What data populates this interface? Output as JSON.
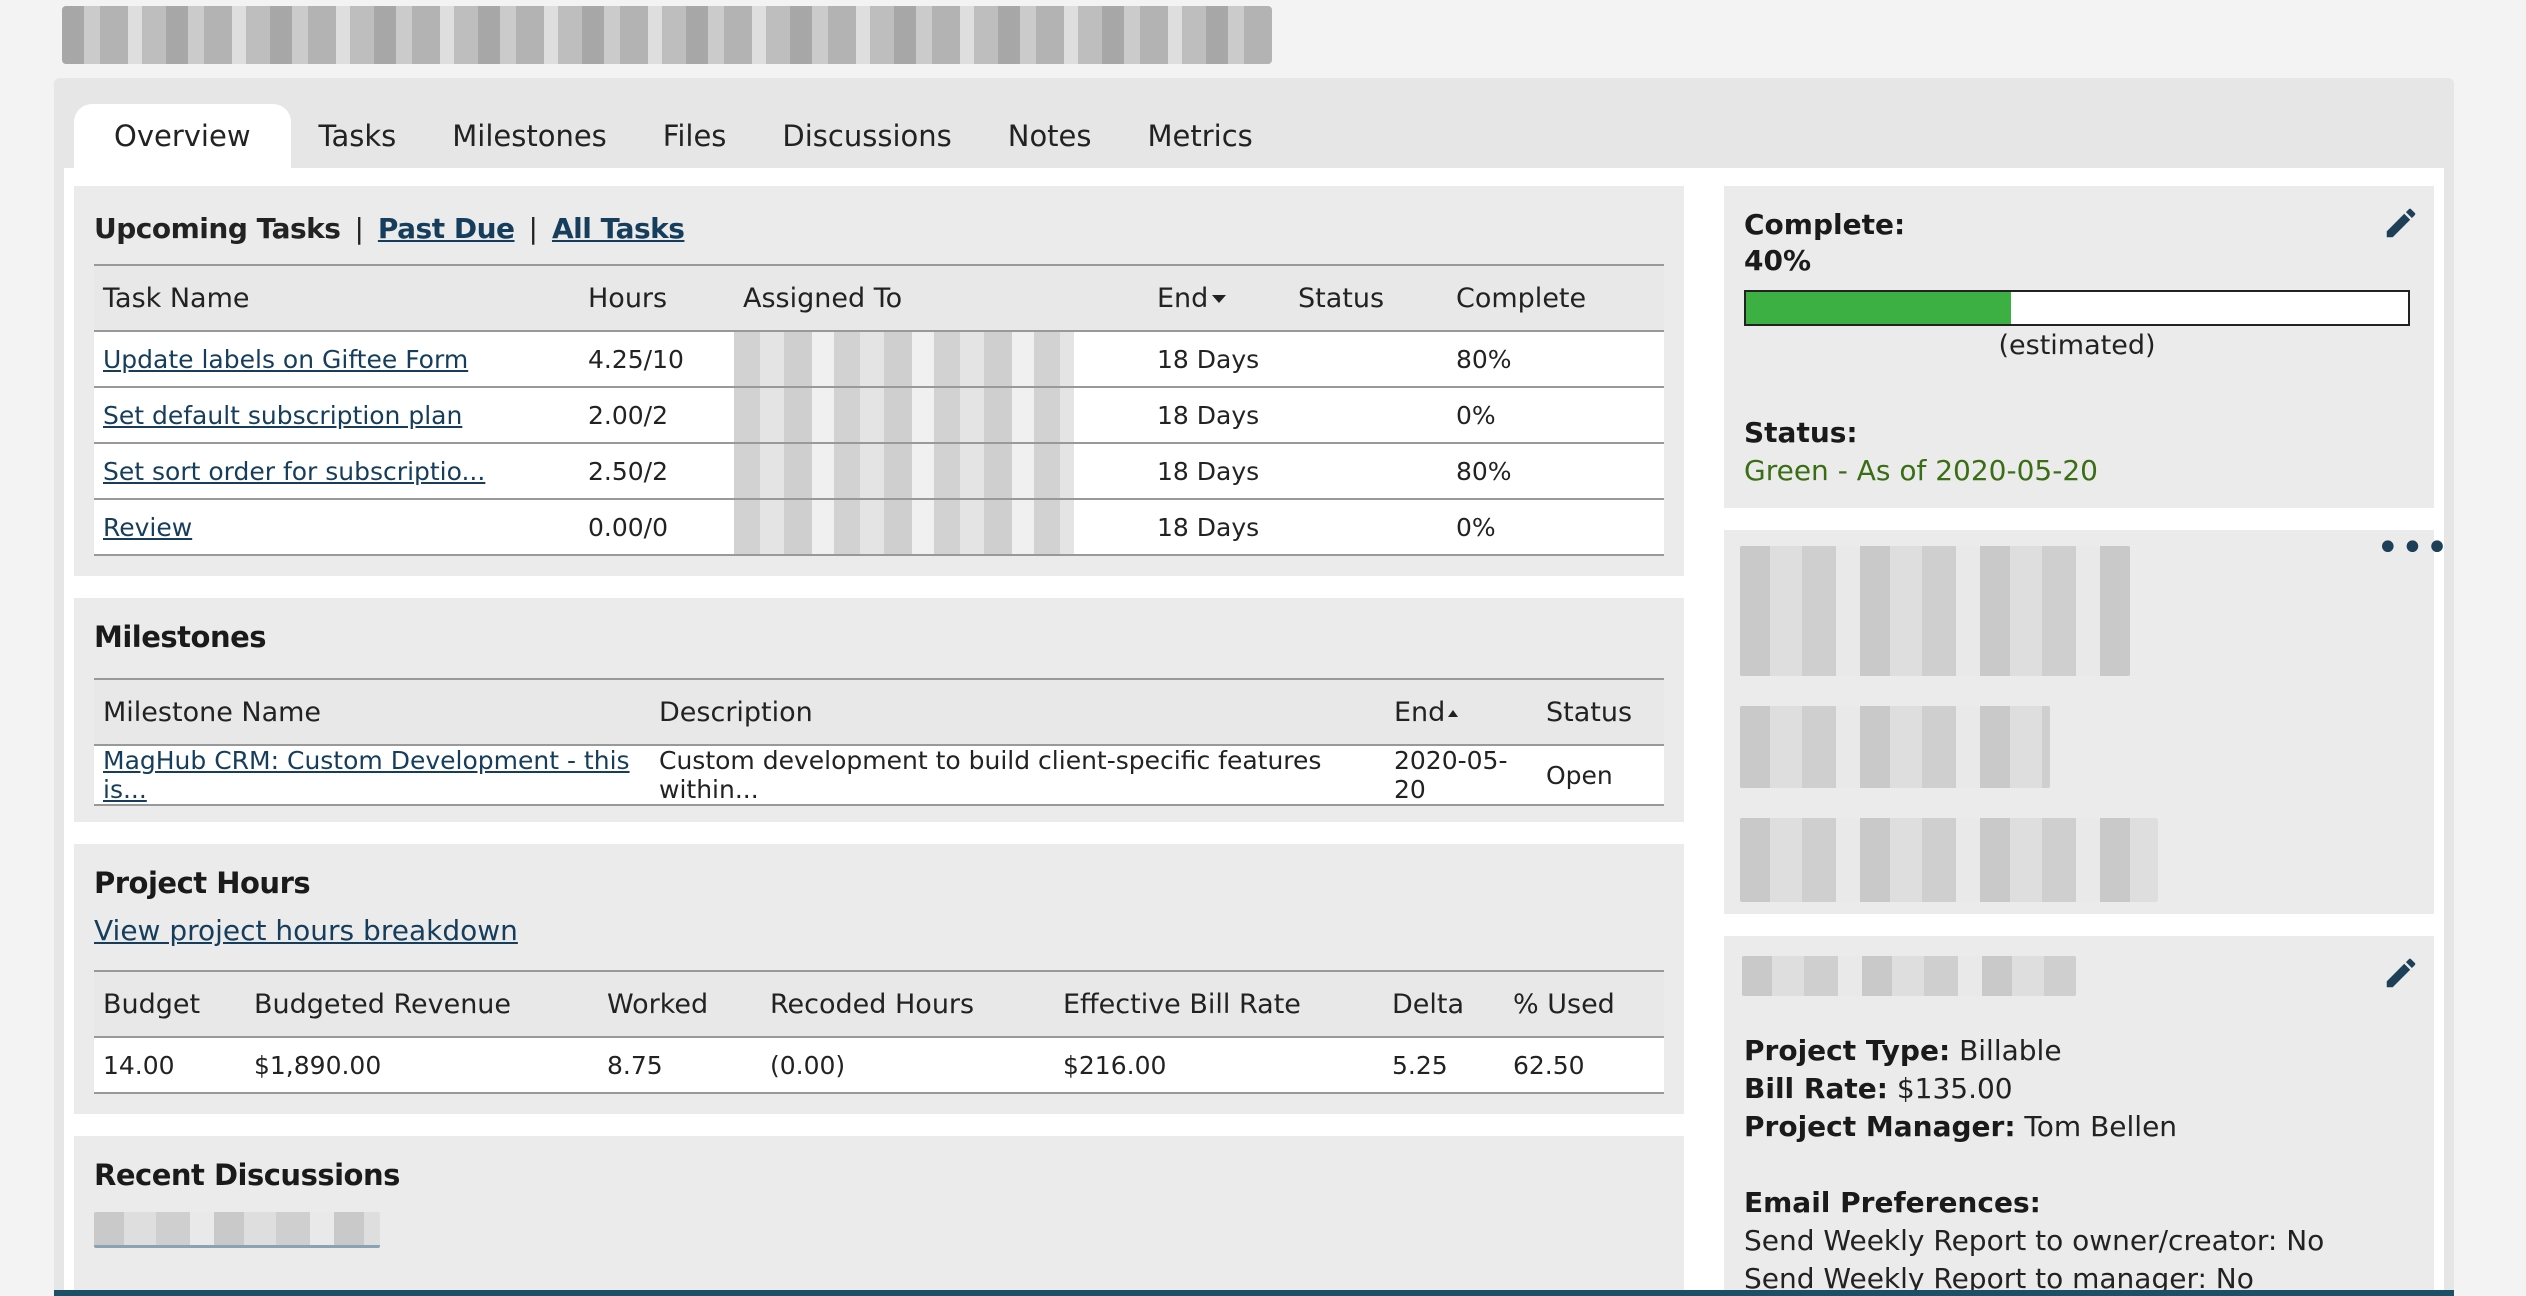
{
  "tabs": [
    "Overview",
    "Tasks",
    "Milestones",
    "Files",
    "Discussions",
    "Notes",
    "Metrics"
  ],
  "upcoming": {
    "title": "Upcoming Tasks",
    "sep": "|",
    "past_due": "Past Due",
    "all_tasks": "All Tasks",
    "headers": [
      "Task Name",
      "Hours",
      "Assigned To",
      "End",
      "Status",
      "Complete"
    ],
    "end_sort_icon": "sort-down-caret",
    "rows": [
      {
        "name": "Update labels on Giftee Form",
        "hours": "4.25/10",
        "end": "18 Days",
        "status": "",
        "complete": "80%"
      },
      {
        "name": "Set default subscription plan",
        "hours": "2.00/2",
        "end": "18 Days",
        "status": "",
        "complete": "0%"
      },
      {
        "name": "Set sort order for subscriptio...",
        "hours": "2.50/2",
        "end": "18 Days",
        "status": "",
        "complete": "80%"
      },
      {
        "name": "Review",
        "hours": "0.00/0",
        "end": "18 Days",
        "status": "",
        "complete": "0%"
      }
    ]
  },
  "milestones": {
    "title": "Milestones",
    "headers": [
      "Milestone Name",
      "Description",
      "End",
      "Status"
    ],
    "rows": [
      {
        "name": "MagHub CRM: Custom Development - this is...",
        "description": "Custom development to build client-specific features within...",
        "end": "2020-05-20",
        "status": "Open"
      }
    ]
  },
  "project_hours": {
    "title": "Project Hours",
    "link": "View project hours breakdown",
    "headers": [
      "Budget",
      "Budgeted Revenue",
      "Worked",
      "Recoded Hours",
      "Effective Bill Rate",
      "Delta",
      "% Used"
    ],
    "row": [
      "14.00",
      "$1,890.00",
      "8.75",
      "(0.00)",
      "$216.00",
      "5.25",
      "62.50"
    ]
  },
  "recent_discussions": {
    "title": "Recent Discussions"
  },
  "status_panel": {
    "complete_label": "Complete:",
    "complete_value": "40%",
    "progress_fraction": 0.4,
    "estimated": "(estimated)",
    "status_label": "Status:",
    "status_value": "Green - As of 2020-05-20"
  },
  "details_panel": {
    "project_type_label": "Project Type:",
    "project_type": "Billable",
    "bill_rate_label": "Bill Rate:",
    "bill_rate": "$135.00",
    "pm_label": "Project Manager:",
    "pm": "Tom Bellen",
    "email_prefs_label": "Email Preferences:",
    "pref1": "Send Weekly Report to owner/creator: No",
    "pref2": "Send Weekly Report to manager: No"
  },
  "icons": {
    "edit": "pencil-icon",
    "more": "ellipsis-icon"
  },
  "colors": {
    "progress": "#3cb043",
    "status_green": "#3a6e14",
    "link": "#163e5c",
    "accent": "#1d4f66"
  }
}
